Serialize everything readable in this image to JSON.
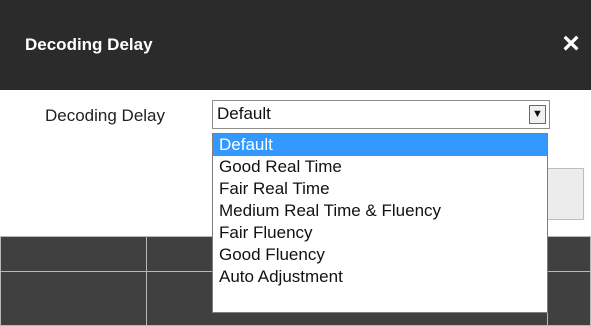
{
  "dialog": {
    "title": "Decoding Delay",
    "close_symbol": "×",
    "field_label": "Decoding Delay",
    "select_value": "Default",
    "arrow_symbol": "▼",
    "options": [
      "Default",
      "Good Real Time",
      "Fair Real Time",
      "Medium Real Time & Fluency",
      "Fair Fluency",
      "Good Fluency",
      "Auto Adjustment"
    ],
    "selected_index": 0
  },
  "colors": {
    "titlebar": "#2b2b2b",
    "selected_option": "#3399ff",
    "video_background": "#3a3a3a"
  }
}
